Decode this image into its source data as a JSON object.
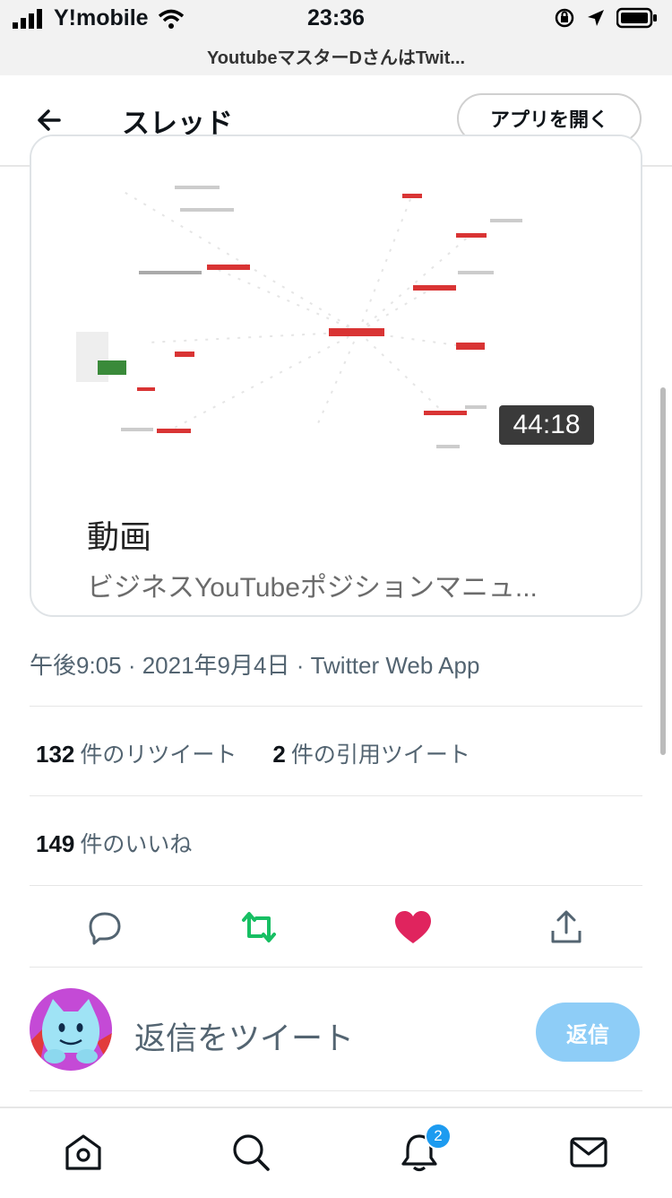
{
  "status_bar": {
    "carrier": "Y!mobile",
    "time": "23:36",
    "url": "YoutubeマスターDさんはTwit..."
  },
  "header": {
    "title": "スレッド",
    "open_app_label": "アプリを開く"
  },
  "video_card": {
    "duration": "44:18",
    "title": "動画",
    "description": "ビジネスYouTubeポジションマニュ..."
  },
  "tweet_meta": "午後9:05 · 2021年9月4日 · Twitter Web App",
  "stats": {
    "retweets_count": "132",
    "retweets_label": "件のリツイート",
    "quotes_count": "2",
    "quotes_label": "件の引用ツイート",
    "likes_count": "149",
    "likes_label": "件のいいね"
  },
  "actions": [
    "reply-icon",
    "retweet-icon",
    "like-icon",
    "share-icon"
  ],
  "colors": {
    "retweet": "#17bf63",
    "like": "#e0245e",
    "reply_button": "#8ecdf7",
    "badge": "#1d9bf0"
  },
  "reply": {
    "placeholder": "返信をツイート",
    "button_label": "返信"
  },
  "bottom_nav": {
    "items": [
      "home-icon",
      "search-icon",
      "notifications-icon",
      "messages-icon"
    ],
    "notification_badge": "2"
  }
}
